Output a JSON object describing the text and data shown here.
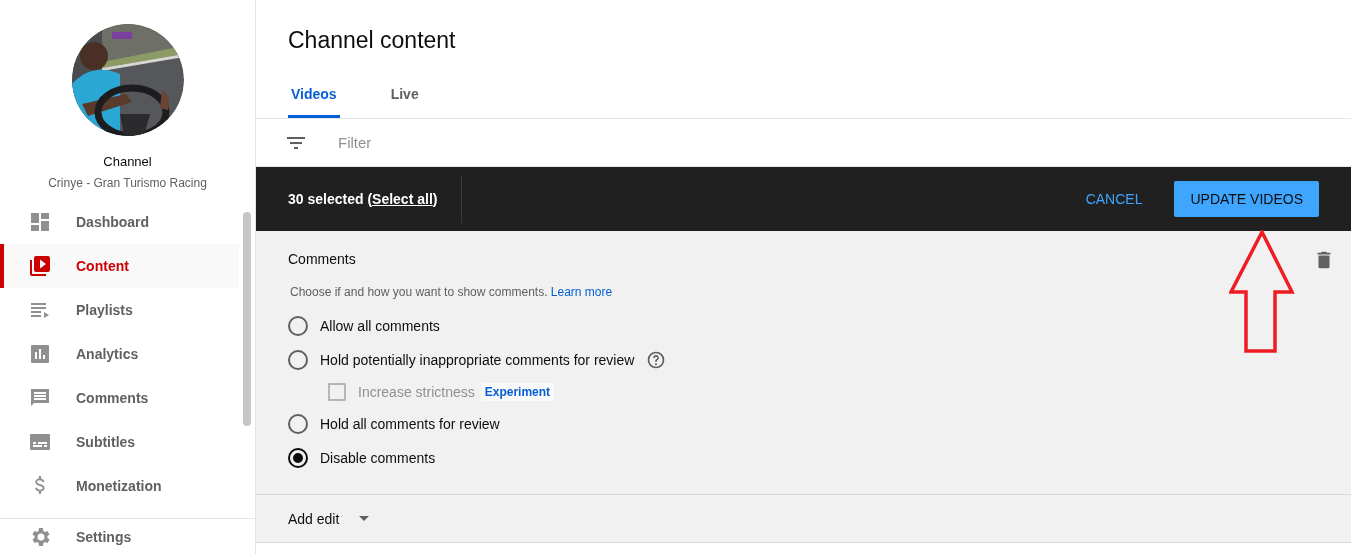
{
  "sidebar": {
    "channel_label": "Channel",
    "channel_name": "Crinye - Gran Turismo Racing",
    "items": [
      {
        "kind": "dashboard",
        "label": "Dashboard",
        "selected": false
      },
      {
        "kind": "content",
        "label": "Content",
        "selected": true
      },
      {
        "kind": "playlists",
        "label": "Playlists",
        "selected": false
      },
      {
        "kind": "analytics",
        "label": "Analytics",
        "selected": false
      },
      {
        "kind": "comments",
        "label": "Comments",
        "selected": false
      },
      {
        "kind": "subtitles",
        "label": "Subtitles",
        "selected": false
      },
      {
        "kind": "monetization",
        "label": "Monetization",
        "selected": false
      }
    ],
    "footer_items": [
      {
        "kind": "settings",
        "label": "Settings"
      }
    ]
  },
  "page": {
    "title": "Channel content",
    "tabs": [
      {
        "label": "Videos",
        "selected": true
      },
      {
        "label": "Live",
        "selected": false
      }
    ],
    "filter": {
      "placeholder": "Filter"
    }
  },
  "selection_bar": {
    "summary_before": "30 selected (",
    "select_all": "Select all",
    "summary_after": ")",
    "buttons": [
      {
        "kind": "text",
        "label": "CANCEL"
      },
      {
        "kind": "filled",
        "label": "UPDATE VIDEOS"
      }
    ]
  },
  "edit_panel": {
    "title": "Comments",
    "description": "Choose if and how you want to show comments.",
    "learn_more": "Learn more",
    "options": [
      {
        "kind": "radio",
        "label": "Allow all comments",
        "selected": false,
        "help": false
      },
      {
        "kind": "radio",
        "label": "Hold potentially inappropriate comments for review",
        "selected": false,
        "help": true
      },
      {
        "kind": "checkbox",
        "label": "Increase strictness",
        "checked": false,
        "disabled": true,
        "badge": "Experiment"
      },
      {
        "kind": "radio",
        "label": "Hold all comments for review",
        "selected": false,
        "help": false
      },
      {
        "kind": "radio",
        "label": "Disable comments",
        "selected": true,
        "help": false
      }
    ]
  },
  "add_edit": {
    "label": "Add edit"
  }
}
